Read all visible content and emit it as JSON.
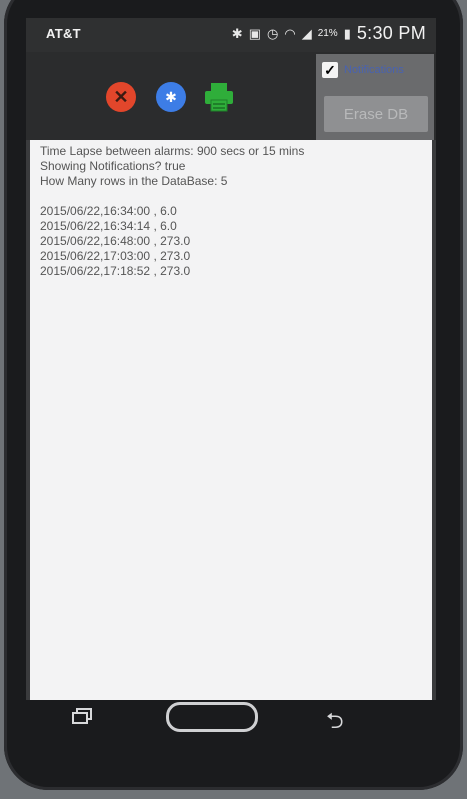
{
  "status_bar": {
    "carrier": "AT&T",
    "icons": [
      "bluetooth-icon",
      "nfc-icon",
      "alarm-icon",
      "wifi-icon",
      "signal-icon",
      "battery-icon"
    ],
    "battery": "21%",
    "time": "5:30 PM"
  },
  "toolbar": {
    "close_icon": "close-icon",
    "bluetooth_icon": "bluetooth-icon",
    "print_icon": "printer-icon",
    "checkbox_label": "Notifications",
    "checkbox_checked": true,
    "erase_label": "Erase DB"
  },
  "content": {
    "line1": "Time Lapse between alarms: 900 secs or 15 mins",
    "line2": "Showing Notifications? true",
    "line3": "How Many rows in the DataBase:  5",
    "rows": [
      "2015/06/22,16:34:00 , 6.0",
      "2015/06/22,16:34:14 , 6.0",
      "2015/06/22,16:48:00 , 273.0",
      "2015/06/22,17:03:00 , 273.0",
      "2015/06/22,17:18:52 , 273.0"
    ]
  },
  "colors": {
    "close": "#e2462b",
    "bluetooth": "#3d7de6",
    "printer": "#2fae3a",
    "screen_bg": "#f3f3f4"
  }
}
